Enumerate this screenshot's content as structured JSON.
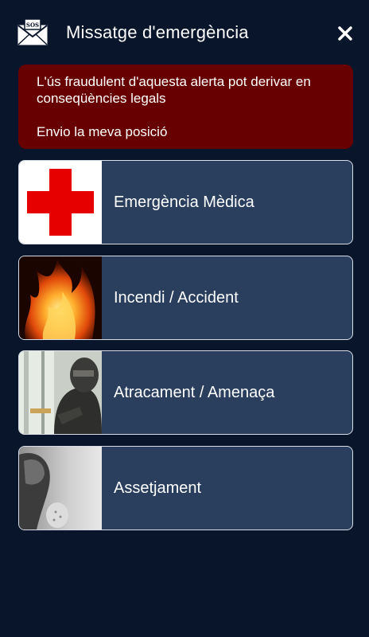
{
  "header": {
    "title": "Missatge d'emergència",
    "sos_icon_text": "SOS",
    "close_icon": "close-icon"
  },
  "warning": {
    "line1": "L'ús fraudulent d'aquesta alerta pot derivar en conseqüències legals",
    "line2": "Envio la meva posició"
  },
  "options": [
    {
      "label": "Emergència Mèdica",
      "icon": "red-cross-icon"
    },
    {
      "label": "Incendi / Accident",
      "icon": "fire-image"
    },
    {
      "label": "Atracament / Amenaça",
      "icon": "burglar-image"
    },
    {
      "label": "Assetjament",
      "icon": "harassment-image"
    }
  ],
  "colors": {
    "background": "#09152a",
    "warning_bg": "#670000",
    "card_bg": "#2a3f5e",
    "card_border": "#d9dee6",
    "red_cross": "#e60000"
  }
}
